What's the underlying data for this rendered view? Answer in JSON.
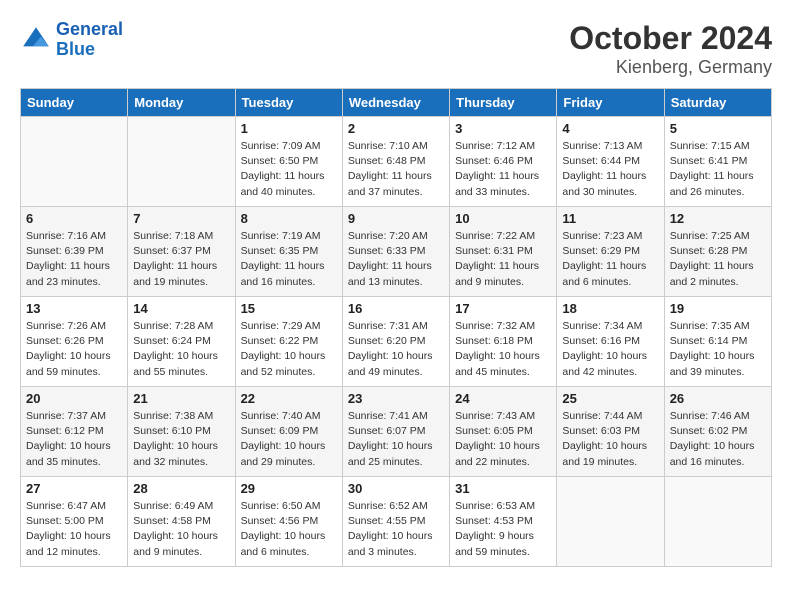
{
  "logo": {
    "line1": "General",
    "line2": "Blue"
  },
  "title": "October 2024",
  "subtitle": "Kienberg, Germany",
  "headers": [
    "Sunday",
    "Monday",
    "Tuesday",
    "Wednesday",
    "Thursday",
    "Friday",
    "Saturday"
  ],
  "weeks": [
    [
      {
        "day": "",
        "info": ""
      },
      {
        "day": "",
        "info": ""
      },
      {
        "day": "1",
        "info": "Sunrise: 7:09 AM\nSunset: 6:50 PM\nDaylight: 11 hours\nand 40 minutes."
      },
      {
        "day": "2",
        "info": "Sunrise: 7:10 AM\nSunset: 6:48 PM\nDaylight: 11 hours\nand 37 minutes."
      },
      {
        "day": "3",
        "info": "Sunrise: 7:12 AM\nSunset: 6:46 PM\nDaylight: 11 hours\nand 33 minutes."
      },
      {
        "day": "4",
        "info": "Sunrise: 7:13 AM\nSunset: 6:44 PM\nDaylight: 11 hours\nand 30 minutes."
      },
      {
        "day": "5",
        "info": "Sunrise: 7:15 AM\nSunset: 6:41 PM\nDaylight: 11 hours\nand 26 minutes."
      }
    ],
    [
      {
        "day": "6",
        "info": "Sunrise: 7:16 AM\nSunset: 6:39 PM\nDaylight: 11 hours\nand 23 minutes."
      },
      {
        "day": "7",
        "info": "Sunrise: 7:18 AM\nSunset: 6:37 PM\nDaylight: 11 hours\nand 19 minutes."
      },
      {
        "day": "8",
        "info": "Sunrise: 7:19 AM\nSunset: 6:35 PM\nDaylight: 11 hours\nand 16 minutes."
      },
      {
        "day": "9",
        "info": "Sunrise: 7:20 AM\nSunset: 6:33 PM\nDaylight: 11 hours\nand 13 minutes."
      },
      {
        "day": "10",
        "info": "Sunrise: 7:22 AM\nSunset: 6:31 PM\nDaylight: 11 hours\nand 9 minutes."
      },
      {
        "day": "11",
        "info": "Sunrise: 7:23 AM\nSunset: 6:29 PM\nDaylight: 11 hours\nand 6 minutes."
      },
      {
        "day": "12",
        "info": "Sunrise: 7:25 AM\nSunset: 6:28 PM\nDaylight: 11 hours\nand 2 minutes."
      }
    ],
    [
      {
        "day": "13",
        "info": "Sunrise: 7:26 AM\nSunset: 6:26 PM\nDaylight: 10 hours\nand 59 minutes."
      },
      {
        "day": "14",
        "info": "Sunrise: 7:28 AM\nSunset: 6:24 PM\nDaylight: 10 hours\nand 55 minutes."
      },
      {
        "day": "15",
        "info": "Sunrise: 7:29 AM\nSunset: 6:22 PM\nDaylight: 10 hours\nand 52 minutes."
      },
      {
        "day": "16",
        "info": "Sunrise: 7:31 AM\nSunset: 6:20 PM\nDaylight: 10 hours\nand 49 minutes."
      },
      {
        "day": "17",
        "info": "Sunrise: 7:32 AM\nSunset: 6:18 PM\nDaylight: 10 hours\nand 45 minutes."
      },
      {
        "day": "18",
        "info": "Sunrise: 7:34 AM\nSunset: 6:16 PM\nDaylight: 10 hours\nand 42 minutes."
      },
      {
        "day": "19",
        "info": "Sunrise: 7:35 AM\nSunset: 6:14 PM\nDaylight: 10 hours\nand 39 minutes."
      }
    ],
    [
      {
        "day": "20",
        "info": "Sunrise: 7:37 AM\nSunset: 6:12 PM\nDaylight: 10 hours\nand 35 minutes."
      },
      {
        "day": "21",
        "info": "Sunrise: 7:38 AM\nSunset: 6:10 PM\nDaylight: 10 hours\nand 32 minutes."
      },
      {
        "day": "22",
        "info": "Sunrise: 7:40 AM\nSunset: 6:09 PM\nDaylight: 10 hours\nand 29 minutes."
      },
      {
        "day": "23",
        "info": "Sunrise: 7:41 AM\nSunset: 6:07 PM\nDaylight: 10 hours\nand 25 minutes."
      },
      {
        "day": "24",
        "info": "Sunrise: 7:43 AM\nSunset: 6:05 PM\nDaylight: 10 hours\nand 22 minutes."
      },
      {
        "day": "25",
        "info": "Sunrise: 7:44 AM\nSunset: 6:03 PM\nDaylight: 10 hours\nand 19 minutes."
      },
      {
        "day": "26",
        "info": "Sunrise: 7:46 AM\nSunset: 6:02 PM\nDaylight: 10 hours\nand 16 minutes."
      }
    ],
    [
      {
        "day": "27",
        "info": "Sunrise: 6:47 AM\nSunset: 5:00 PM\nDaylight: 10 hours\nand 12 minutes."
      },
      {
        "day": "28",
        "info": "Sunrise: 6:49 AM\nSunset: 4:58 PM\nDaylight: 10 hours\nand 9 minutes."
      },
      {
        "day": "29",
        "info": "Sunrise: 6:50 AM\nSunset: 4:56 PM\nDaylight: 10 hours\nand 6 minutes."
      },
      {
        "day": "30",
        "info": "Sunrise: 6:52 AM\nSunset: 4:55 PM\nDaylight: 10 hours\nand 3 minutes."
      },
      {
        "day": "31",
        "info": "Sunrise: 6:53 AM\nSunset: 4:53 PM\nDaylight: 9 hours\nand 59 minutes."
      },
      {
        "day": "",
        "info": ""
      },
      {
        "day": "",
        "info": ""
      }
    ]
  ]
}
